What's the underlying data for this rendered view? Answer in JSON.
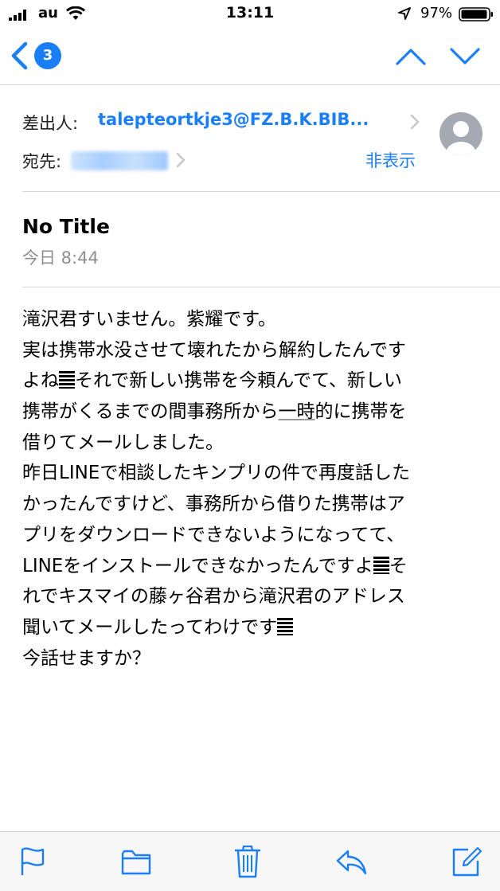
{
  "status_bar": {
    "carrier": "au",
    "time": "13:11",
    "battery": "97%"
  },
  "nav": {
    "unread_count": "3",
    "icons": [
      "back-chevron-icon",
      "up-arrow-icon",
      "down-arrow-icon"
    ]
  },
  "header": {
    "from_label": "差出人:",
    "from_address": "talepteortkje3@FZ.B.K.BIB...",
    "to_label": "宛先:",
    "hide_label": "非表示"
  },
  "message": {
    "subject": "No Title",
    "date": "今日 8:44",
    "body_lines": [
      "滝沢君すいません。紫耀です。",
      "実は携帯水没させて壊れたから解約したんです",
      "それで新しい携帯を今頼んでて、新しい",
      "携帯がくるまでの間事務所から",
      "一時",
      "的に携帯を",
      "借りてメールしました。",
      "昨日LINEで相談したキンプリの件で再度話した",
      "かったんですけど、事務所から借りた携帯はア",
      "プリをダウンロードできないようになってて、",
      "LINEをインストールできなかったんですよ",
      "れでキスマイの藤ヶ谷君から滝沢君のアドレス",
      "聞いてメールしたってわけです",
      "今話せますか？",
      "よね",
      "そ"
    ]
  },
  "toolbar": {
    "icons": [
      "flag-icon",
      "folder-icon",
      "trash-icon",
      "reply-icon",
      "compose-icon"
    ]
  },
  "colors": {
    "accent": "#1a7ef8",
    "secondary_text": "#8e8e93",
    "divider": "#d6d6d6"
  }
}
